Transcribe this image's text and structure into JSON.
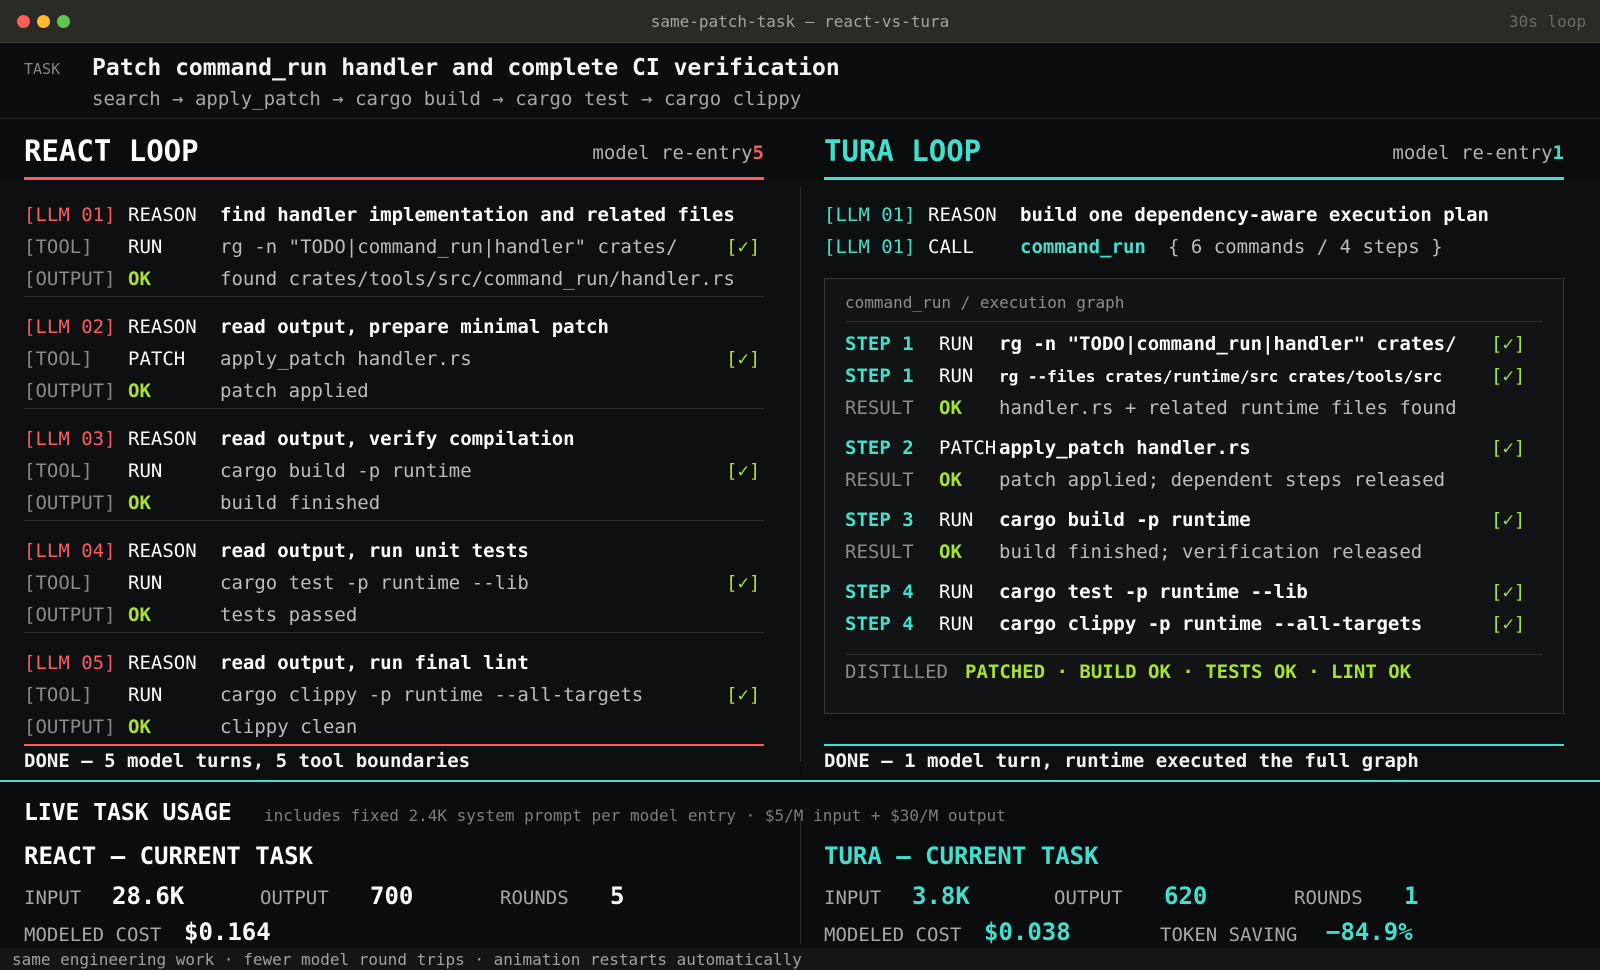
{
  "window": {
    "title": "same-patch-task — react-vs-tura",
    "loop": "30s loop"
  },
  "task": {
    "tag": "TASK",
    "title": "Patch command_run handler and complete CI verification",
    "steps": "search → apply_patch → cargo build → cargo test → cargo clippy"
  },
  "react": {
    "title": "REACT LOOP",
    "reentry_label": "model re-entry",
    "reentry_count": "5",
    "rows": [
      {
        "tag": "[LLM 01]",
        "kind": "REASON",
        "text": "find handler implementation and related files",
        "check": ""
      },
      {
        "tag": "[TOOL]",
        "kind": "RUN",
        "text": "rg -n \"TODO|command_run|handler\" crates/",
        "check": "[✓]"
      },
      {
        "tag": "[OUTPUT]",
        "kind": "OK",
        "text": "found crates/tools/src/command_run/handler.rs",
        "check": ""
      },
      {
        "tag": "[LLM 02]",
        "kind": "REASON",
        "text": "read output, prepare minimal patch",
        "check": ""
      },
      {
        "tag": "[TOOL]",
        "kind": "PATCH",
        "text": "apply_patch handler.rs",
        "check": "[✓]"
      },
      {
        "tag": "[OUTPUT]",
        "kind": "OK",
        "text": "patch applied",
        "check": ""
      },
      {
        "tag": "[LLM 03]",
        "kind": "REASON",
        "text": "read output, verify compilation",
        "check": ""
      },
      {
        "tag": "[TOOL]",
        "kind": "RUN",
        "text": "cargo build -p runtime",
        "check": "[✓]"
      },
      {
        "tag": "[OUTPUT]",
        "kind": "OK",
        "text": "build finished",
        "check": ""
      },
      {
        "tag": "[LLM 04]",
        "kind": "REASON",
        "text": "read output, run unit tests",
        "check": ""
      },
      {
        "tag": "[TOOL]",
        "kind": "RUN",
        "text": "cargo test -p runtime --lib",
        "check": "[✓]"
      },
      {
        "tag": "[OUTPUT]",
        "kind": "OK",
        "text": "tests passed",
        "check": ""
      },
      {
        "tag": "[LLM 05]",
        "kind": "REASON",
        "text": "read output, run final lint",
        "check": ""
      },
      {
        "tag": "[TOOL]",
        "kind": "RUN",
        "text": "cargo clippy -p runtime --all-targets",
        "check": "[✓]"
      },
      {
        "tag": "[OUTPUT]",
        "kind": "OK",
        "text": "clippy clean",
        "check": ""
      }
    ],
    "done": "DONE — 5 model turns, 5 tool boundaries"
  },
  "tura": {
    "title": "TURA LOOP",
    "reentry_label": "model re-entry",
    "reentry_count": "1",
    "reason": {
      "tag": "[LLM 01]",
      "kind": "REASON",
      "text": "build one dependency-aware execution plan"
    },
    "call": {
      "tag": "[LLM 01]",
      "kind": "CALL",
      "cmd": "command_run",
      "text": "{ 6 commands / 4 steps }"
    },
    "graph_title": "command_run / execution graph",
    "graph_rows": [
      {
        "tag": "STEP 1",
        "kind": "RUN",
        "text": "rg -n \"TODO|command_run|handler\" crates/",
        "check": "[✓]"
      },
      {
        "tag": "STEP 1",
        "kind": "RUN",
        "text": "rg --files crates/runtime/src crates/tools/src",
        "check": "[✓]"
      },
      {
        "tag": "RESULT",
        "kind": "OK",
        "text": "handler.rs + related runtime files found",
        "check": ""
      },
      {
        "tag": "STEP 2",
        "kind": "PATCH",
        "text": "apply_patch handler.rs",
        "check": "[✓]"
      },
      {
        "tag": "RESULT",
        "kind": "OK",
        "text": "patch applied; dependent steps released",
        "check": ""
      },
      {
        "tag": "STEP 3",
        "kind": "RUN",
        "text": "cargo build -p runtime",
        "check": "[✓]"
      },
      {
        "tag": "RESULT",
        "kind": "OK",
        "text": "build finished; verification released",
        "check": ""
      },
      {
        "tag": "STEP 4",
        "kind": "RUN",
        "text": "cargo test -p runtime --lib",
        "check": "[✓]"
      },
      {
        "tag": "STEP 4",
        "kind": "RUN",
        "text": "cargo clippy -p runtime --all-targets",
        "check": "[✓]"
      }
    ],
    "distilled_label": "DISTILLED",
    "distilled_value": "PATCHED · BUILD OK · TESTS OK · LINT OK",
    "done": "DONE — 1 model turn, runtime executed the full graph"
  },
  "usage": {
    "title": "LIVE TASK USAGE",
    "note": "includes fixed 2.4K system prompt per model entry · $5/M input + $30/M output",
    "react": {
      "heading": "REACT — CURRENT TASK",
      "input_label": "INPUT",
      "input": "28.6K",
      "output_label": "OUTPUT",
      "output": "700",
      "rounds_label": "ROUNDS",
      "rounds": "5",
      "cost_label": "MODELED COST",
      "cost": "$0.164"
    },
    "tura": {
      "heading": "TURA — CURRENT TASK",
      "input_label": "INPUT",
      "input": "3.8K",
      "output_label": "OUTPUT",
      "output": "620",
      "rounds_label": "ROUNDS",
      "rounds": "1",
      "cost_label": "MODELED COST",
      "cost": "$0.038",
      "saving_label": "TOKEN SAVING",
      "saving": "−84.9%"
    }
  },
  "footer": "same engineering work · fewer model round trips · animation restarts automatically",
  "colors": {
    "react_accent": "#ff5a62",
    "tura_accent": "#3fe0cf",
    "ok": "#a6e22e",
    "background": "#0b0c0d"
  }
}
